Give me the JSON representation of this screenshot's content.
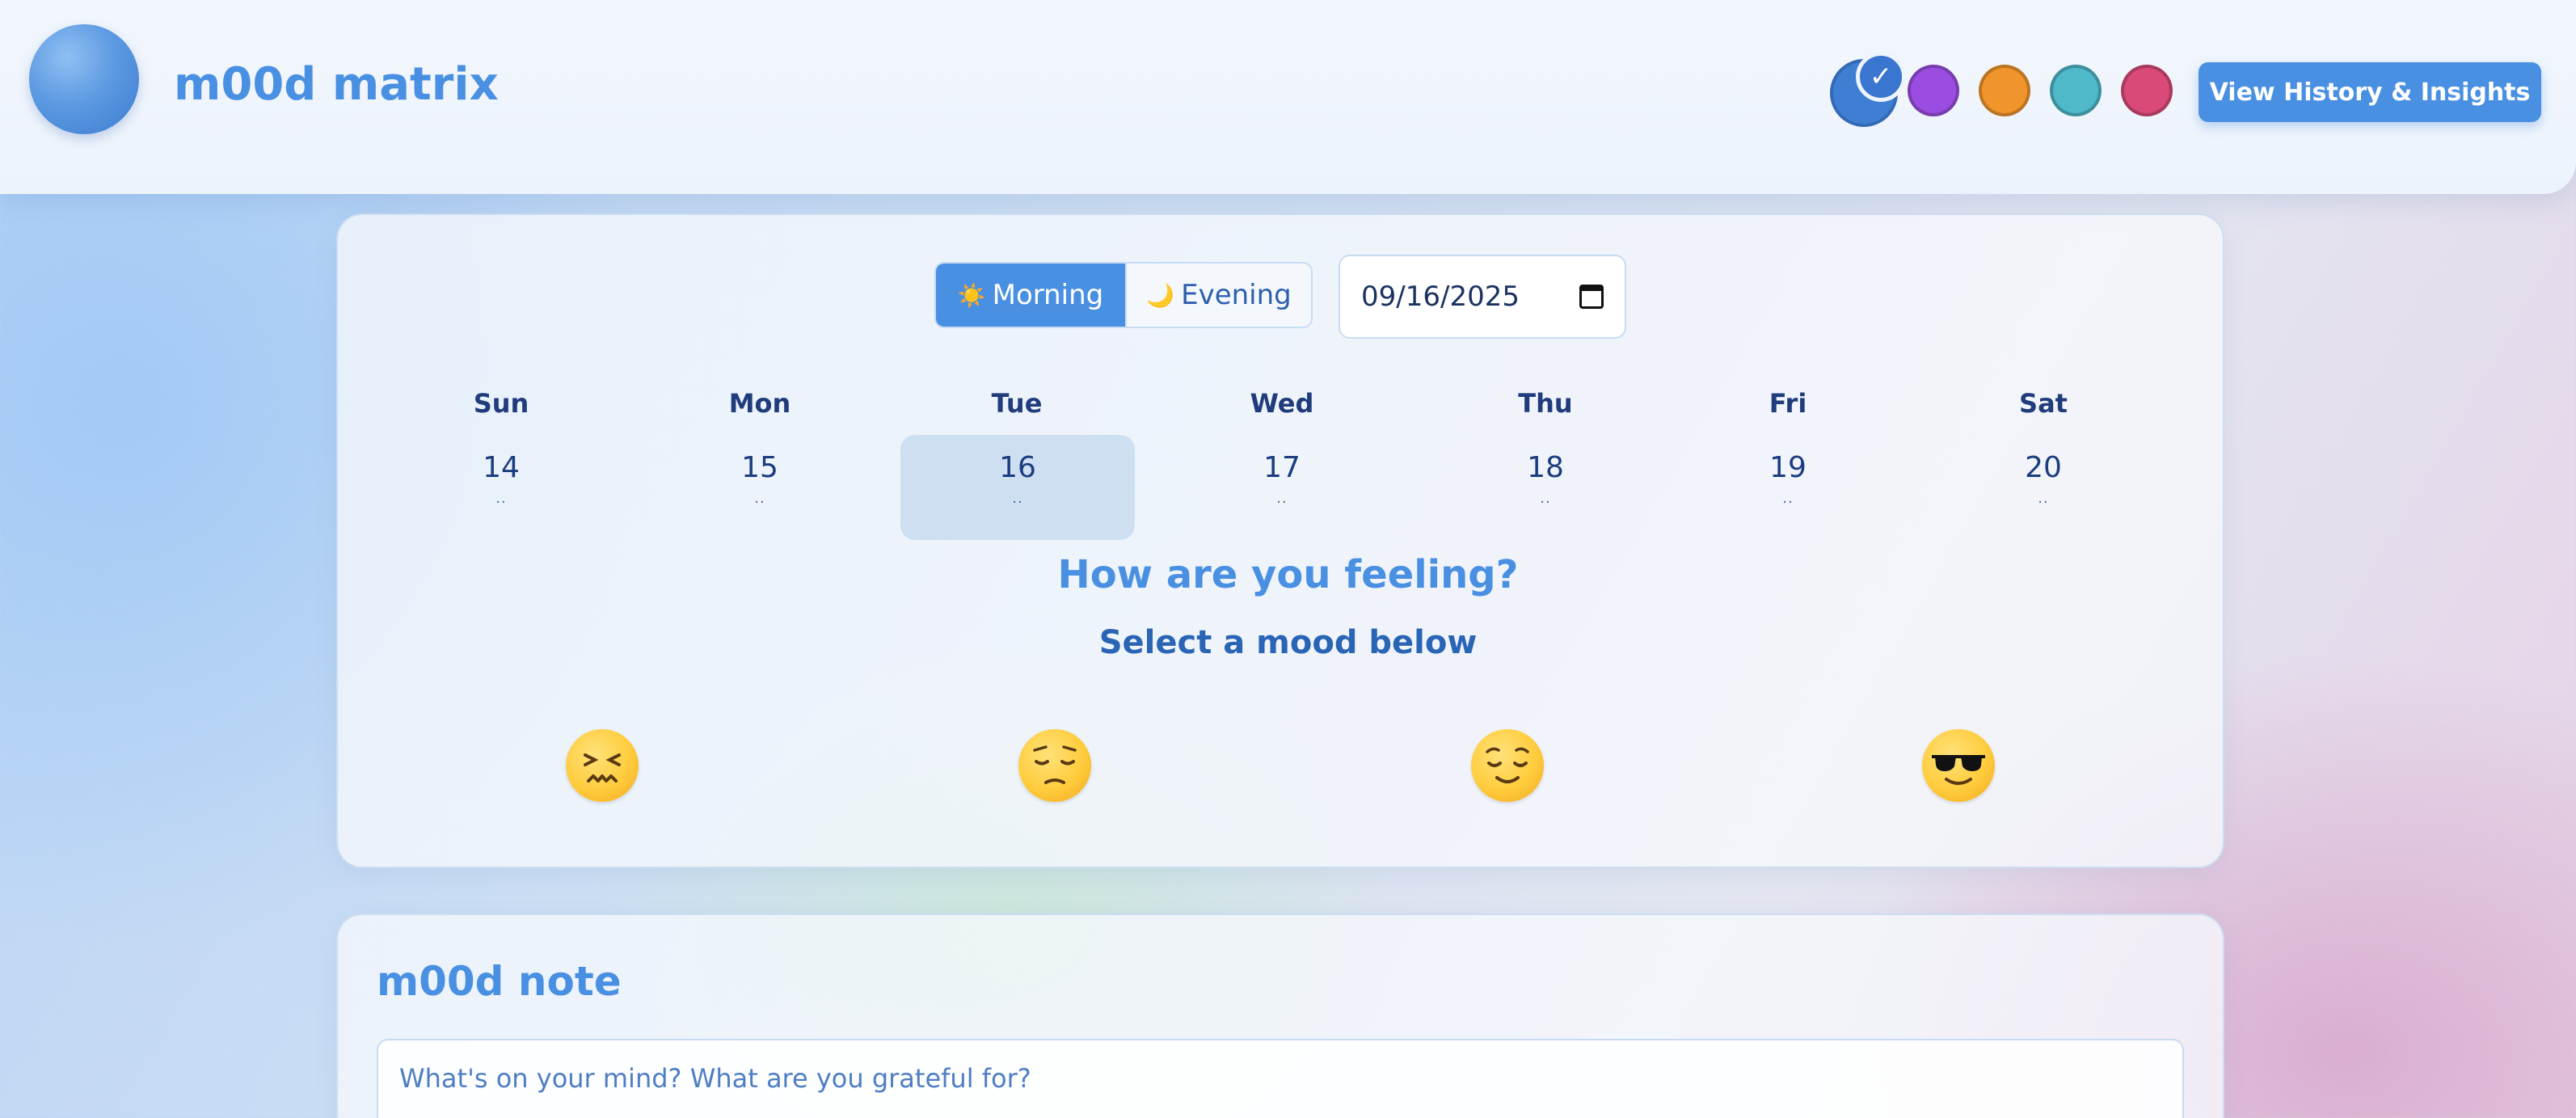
{
  "header": {
    "title": "m00d matrix",
    "history_button": "View History & Insights",
    "theme_swatches": [
      {
        "name": "blue",
        "color": "#3f7fd3",
        "selected": true
      },
      {
        "name": "purple",
        "color": "#9a4de0",
        "selected": false
      },
      {
        "name": "orange",
        "color": "#f0952c",
        "selected": false
      },
      {
        "name": "teal",
        "color": "#4fb8c9",
        "selected": false
      },
      {
        "name": "pink",
        "color": "#d94a78",
        "selected": false
      }
    ],
    "selected_mark": "✓"
  },
  "entry": {
    "time_toggle": {
      "morning_icon": "☀️",
      "morning_label": "Morning",
      "evening_icon": "🌙",
      "evening_label": "Evening",
      "selected": "Morning"
    },
    "date_value": "09/16/2025"
  },
  "week": {
    "days": [
      {
        "dow": "Sun",
        "date": "14",
        "dots": "..",
        "selected": false
      },
      {
        "dow": "Mon",
        "date": "15",
        "dots": "..",
        "selected": false
      },
      {
        "dow": "Tue",
        "date": "16",
        "dots": "..",
        "selected": true
      },
      {
        "dow": "Wed",
        "date": "17",
        "dots": "..",
        "selected": false
      },
      {
        "dow": "Thu",
        "date": "18",
        "dots": "..",
        "selected": false
      },
      {
        "dow": "Fri",
        "date": "19",
        "dots": "..",
        "selected": false
      },
      {
        "dow": "Sat",
        "date": "20",
        "dots": "..",
        "selected": false
      }
    ]
  },
  "mood": {
    "heading": "How are you feeling?",
    "subheading": "Select a mood below",
    "options": [
      "confounded-face-icon",
      "pensive-face-icon",
      "relieved-face-icon",
      "sunglasses-face-icon"
    ]
  },
  "note": {
    "title": "m00d note",
    "placeholder": "What's on your mind? What are you grateful for?"
  }
}
